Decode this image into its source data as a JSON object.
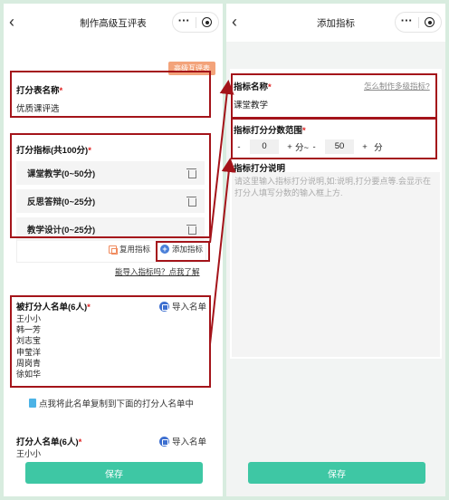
{
  "left": {
    "nav_title": "制作高级互评表",
    "tag": "高级互评表",
    "form_name_label": "打分表名称",
    "form_name_value": "优质课评选",
    "indicators_label": "打分指标(共100分)",
    "indicators": [
      {
        "label": "课堂教学(0~50分)"
      },
      {
        "label": "反思答辩(0~25分)"
      },
      {
        "label": "教学设计(0~25分)"
      }
    ],
    "reuse_label": "复用指标",
    "add_label": "添加指标",
    "import_link": "能导入指标吗？点我了解",
    "rated_label": "被打分人名单(6人)",
    "import_names": "导入名单",
    "rated_names": [
      "王小小",
      "韩一芳",
      "刘志宝",
      "申莹洋",
      "周岗青",
      "徐如华"
    ],
    "copy_hint": "点我将此名单复制到下面的打分人名单中",
    "raters_label": "打分人名单(6人)",
    "raters_names": [
      "王小小"
    ],
    "save": "保存"
  },
  "right": {
    "nav_title": "添加指标",
    "name_label": "指标名称",
    "help_link": "怎么制作多级指标?",
    "name_value": "课堂教学",
    "range_label": "指标打分分数范围",
    "range_min": "0",
    "range_max": "50",
    "minus": "-",
    "plus": "+",
    "unit_to": "分~",
    "unit": "分",
    "desc_label": "指标打分说明",
    "desc_placeholder": "请这里输入指标打分说明,如:说明,打分要点等.会显示在打分人填写分数的输入框上方.",
    "save": "保存"
  },
  "colors": {
    "accent": "#3ec7a4",
    "highlight": "#a4141a",
    "required": "#e02020",
    "tag": "#f3a37a"
  },
  "icons": [
    "back-icon",
    "more-icon",
    "target-icon",
    "trash-icon",
    "copy-icon",
    "plus-circle-icon",
    "import-icon",
    "document-icon"
  ]
}
